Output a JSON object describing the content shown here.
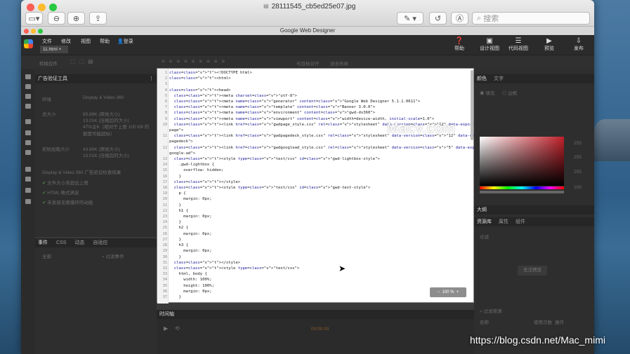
{
  "viewer": {
    "title": "28111545_cb5ed25e07.jpg",
    "search_placeholder": "搜索"
  },
  "gwd": {
    "title": "Google Web Designer",
    "menu": [
      "文件",
      "修改",
      "视图",
      "帮助"
    ],
    "login": "登录",
    "file_tab": "11.html",
    "right_tools": [
      "帮助",
      "设计视图",
      "代码视图",
      "预览",
      "发布"
    ],
    "row2_labels": [
      "转换控件",
      "与目标对齐",
      "适合布局"
    ]
  },
  "left_panel": {
    "title": "广告验证工具",
    "rows": [
      {
        "label": "环境",
        "value": "Display & Video 360"
      },
      {
        "label": "总大小",
        "value": "65.89K (原始大小)"
      },
      {
        "label": "",
        "value": "13.01K (压缩后的大小)"
      },
      {
        "label": "",
        "value": "47%主K（相对于上限 100 KB 的额度可能超标）"
      },
      {
        "label": "初始加载大小",
        "value": "43.89K (原始大小)"
      },
      {
        "label": "",
        "value": "13.01K (压缩后的大小)"
      }
    ],
    "section": "Display & Video 360 广告验证检查结果",
    "checks": [
      "文件大小未超出上限",
      "HTML 格式满足",
      "未发现无限循环的动画"
    ],
    "tabs": [
      "事件",
      "CSS",
      "动态",
      "自适应"
    ],
    "filter_all": "全部",
    "filter_search": "过滤事件"
  },
  "editor": {
    "zoom": "100 %",
    "lines": [
      "<!DOCTYPE html>",
      "<html>",
      "",
      "<head>",
      "  <meta charset=\"utf-8\">",
      "  <meta name=\"generator\" content=\"Google Web Designer 5.1.1.0611\">",
      "  <meta name=\"template\" content=\"Banner 3.0.0\">",
      "  <meta name=\"environment\" content=\"gwd-dv360\">",
      "  <meta name=\"viewport\" content=\"width=device-width, initial-scale=1.0\">",
      "  <link href=\"gwdpage_style.css\" rel=\"stylesheet\" data-version=\"12\" data-exports-type=\"gwd-",
      "page\">",
      "  <link href=\"gwdpagedeck_style.css\" rel=\"stylesheet\" data-version=\"12\" data-exports-type=\"gwd-",
      "pagedeck\">",
      "  <link href=\"gwdgooglead_style.css\" rel=\"stylesheet\" data-version=\"5\" data-exports-type=\"gwd-",
      "google-ad\">",
      "  <style type=\"text/css\" id=\"gwd-lightbox-style\">",
      "    .gwd-lightbox {",
      "      overflow: hidden;",
      "    }",
      "  </style>",
      "  <style type=\"text/css\" id=\"gwd-text-style\">",
      "    p {",
      "      margin: 0px;",
      "    }",
      "    h1 {",
      "      margin: 0px;",
      "    }",
      "    h2 {",
      "      margin: 0px;",
      "    }",
      "    h3 {",
      "      margin: 0px;",
      "    }",
      "  </style>",
      "  <style type=\"text/css\">",
      "    html, body {",
      "      width: 100%;",
      "      height: 100%;",
      "      margin: 0px;",
      "    }"
    ],
    "line_numbers": [
      "1",
      "2",
      "3",
      "4",
      "5",
      "6",
      "7",
      "8",
      "9",
      "10",
      "",
      "11",
      "",
      "12",
      "",
      "13",
      "14",
      "15",
      "16",
      "17",
      "18",
      "19",
      "20",
      "21",
      "22",
      "23",
      "24",
      "25",
      "26",
      "27",
      "28",
      "29",
      "30",
      "31",
      "32",
      "33",
      "34",
      "35",
      "36",
      "37"
    ]
  },
  "timeline": {
    "title": "时间轴",
    "time": "00:00.00"
  },
  "right_panel": {
    "tabs1": [
      "颜色",
      "文字"
    ],
    "mode_labels": [
      "填充",
      "边框"
    ],
    "rgb": [
      "255",
      "255",
      "255",
      "100"
    ],
    "outline_title": "大纲",
    "tabs2": [
      "资源库",
      "属性",
      "组件"
    ],
    "filter": "过滤",
    "empty": "无法预览",
    "search_placeholder": "过滤资源",
    "cols": [
      "名称",
      "使用次数",
      "操作"
    ]
  },
  "watermark": "Macv.com",
  "csdn": "https://blog.csdn.net/Mac_mimi"
}
